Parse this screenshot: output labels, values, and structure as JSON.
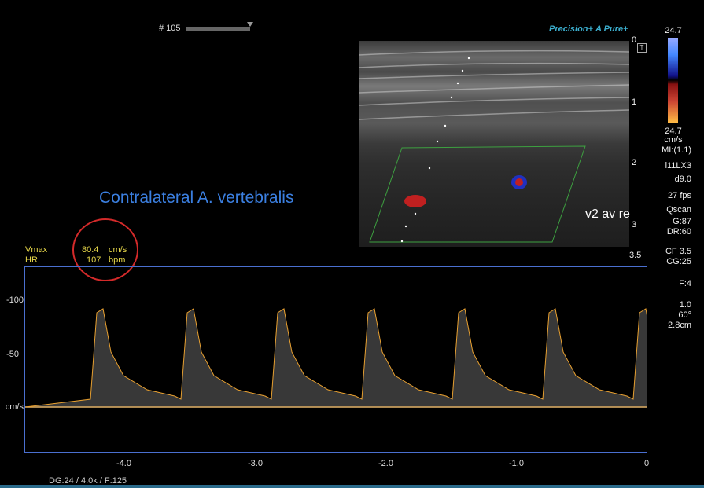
{
  "header": {
    "frame_label": "# 105",
    "brand_precision": "Precision+",
    "brand_apure": "A Pure+"
  },
  "depth_ticks": [
    "0",
    "1",
    "2",
    "3",
    "3.5"
  ],
  "color_scale": {
    "top_value": "24.7",
    "bottom_value": "24.7",
    "unit": "cm/s"
  },
  "params": [
    "MI:(1.1)",
    "i11LX3",
    "d9.0",
    "27 fps",
    "Qscan",
    "G:87",
    "DR:60",
    "CF 3.5",
    "CG:25",
    "F:4",
    "1.0",
    "60°",
    "2.8cm"
  ],
  "annotation": "Contralateral A. vertebralis",
  "vessel_label": "v2 av re",
  "measurements": {
    "vmax_label": "Vmax",
    "vmax_value": "80.4",
    "vmax_unit": "cm/s",
    "hr_label": "HR",
    "hr_value": "107",
    "hr_unit": "bpm"
  },
  "doppler": {
    "velocity_labels": [
      "-100",
      "-50",
      "cm/s"
    ],
    "time_labels": [
      "-4.0",
      "-3.0",
      "-2.0",
      "-1.0",
      "0"
    ]
  },
  "footer": "DG:24   / 4.0k   / F:125",
  "colors": {
    "accent": "#3b7fe0",
    "measure": "#e8d84a",
    "circle": "#d42a2a",
    "envelope": "#e8a030"
  }
}
